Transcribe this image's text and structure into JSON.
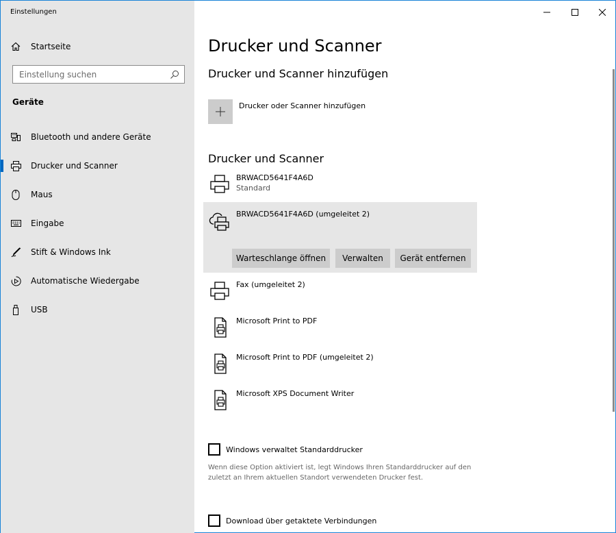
{
  "window": {
    "title": "Einstellungen",
    "controls": {
      "minimize_icon": "minimize-icon",
      "maximize_icon": "maximize-icon",
      "close_icon": "close-icon"
    }
  },
  "sidebar": {
    "home": {
      "label": "Startseite",
      "icon": "home-icon"
    },
    "search": {
      "placeholder": "Einstellung suchen",
      "value": ""
    },
    "group_title": "Geräte",
    "items": [
      {
        "label": "Bluetooth und andere Geräte",
        "icon": "bluetooth-devices-icon",
        "active": false
      },
      {
        "label": "Drucker und Scanner",
        "icon": "printer-icon",
        "active": true
      },
      {
        "label": "Maus",
        "icon": "mouse-icon",
        "active": false
      },
      {
        "label": "Eingabe",
        "icon": "keyboard-icon",
        "active": false
      },
      {
        "label": "Stift & Windows Ink",
        "icon": "pen-icon",
        "active": false
      },
      {
        "label": "Automatische Wiedergabe",
        "icon": "autoplay-icon",
        "active": false
      },
      {
        "label": "USB",
        "icon": "usb-icon",
        "active": false
      }
    ]
  },
  "main": {
    "title": "Drucker und Scanner",
    "add_section_title": "Drucker und Scanner hinzufügen",
    "add_button_label": "Drucker oder Scanner hinzufügen",
    "list_section_title": "Drucker und Scanner",
    "printers": [
      {
        "name": "BRWACD5641F4A6D",
        "status": "Standard",
        "icon": "printer-icon"
      },
      {
        "name": "BRWACD5641F4A6D (umgeleitet 2)",
        "status": "",
        "icon": "cloud-printer-icon"
      },
      {
        "name": "Fax (umgeleitet 2)",
        "status": "",
        "icon": "printer-icon"
      },
      {
        "name": "Microsoft Print to PDF",
        "status": "",
        "icon": "document-printer-icon"
      },
      {
        "name": "Microsoft Print to PDF (umgeleitet 2)",
        "status": "",
        "icon": "document-printer-icon"
      },
      {
        "name": "Microsoft XPS Document Writer",
        "status": "",
        "icon": "document-printer-icon"
      }
    ],
    "selected_actions": {
      "open_queue": "Warteschlange öffnen",
      "manage": "Verwalten",
      "remove": "Gerät entfernen"
    },
    "default_printer_checkbox": {
      "label": "Windows verwaltet Standarddrucker",
      "checked": false
    },
    "default_printer_description": "Wenn diese Option aktiviert ist, legt Windows Ihren Standarddrucker auf den zuletzt an Ihrem aktuellen Standort verwendeten Drucker fest.",
    "metered_checkbox": {
      "label": "Download über getaktete Verbindungen",
      "checked": false
    }
  },
  "colors": {
    "accent": "#0067c0",
    "sidebar_bg": "#e6e6e6",
    "button_bg": "#cccccc",
    "selected_bg": "#e6e6e6"
  }
}
